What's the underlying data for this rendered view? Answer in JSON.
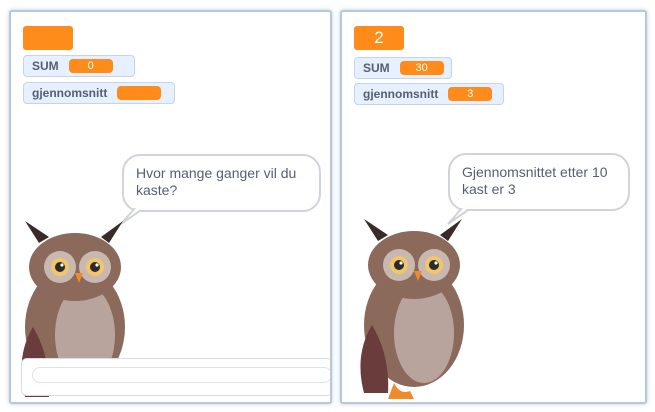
{
  "left_stage": {
    "big_readout": "",
    "sum_monitor": {
      "label": "SUM",
      "value": "0"
    },
    "avg_monitor": {
      "label": "gjennomsnitt",
      "value": ""
    },
    "speech": "Hvor mange ganger vil du kaste?",
    "ask_input": {
      "value": ""
    }
  },
  "right_stage": {
    "big_readout": "2",
    "sum_monitor": {
      "label": "SUM",
      "value": "30"
    },
    "avg_monitor": {
      "label": "gjennomsnitt",
      "value": "3"
    },
    "speech": "Gjennomsnittet etter 10 kast er 3"
  },
  "colors": {
    "monitor_value": "#ff8c1a",
    "monitor_bg": "#e6f0ff",
    "stage_border": "#b7c8d8",
    "owl_body": "#8b6a5c",
    "owl_belly": "#b8a49c"
  },
  "icons": {
    "sprite": "owl-sprite"
  }
}
